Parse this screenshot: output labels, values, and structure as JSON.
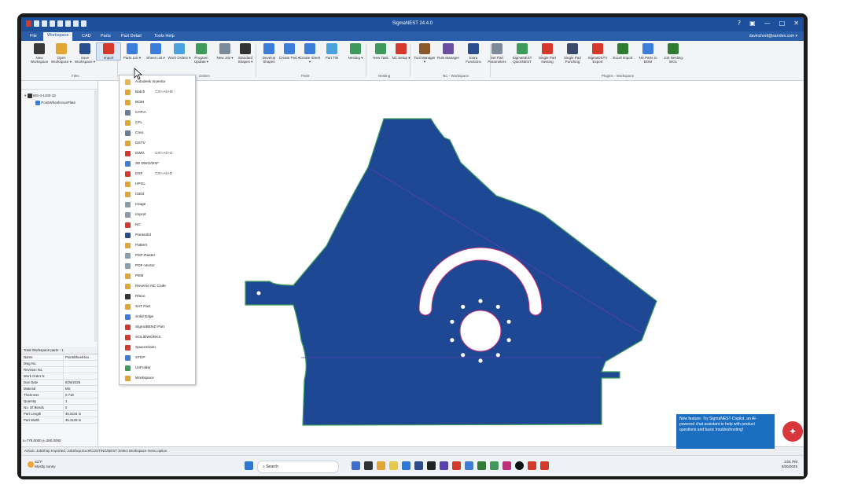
{
  "app": {
    "title": "SigmaNEST 24.4.0",
    "user": "davinchord@sarrdeo.com ▾",
    "window_buttons": [
      "?",
      "▣",
      "—",
      "□",
      "✕"
    ]
  },
  "menu_tabs": [
    "File",
    "Workspace",
    "CAD",
    "Parts",
    "Part Detail",
    "Tools Help"
  ],
  "ribbon": {
    "buttons": [
      {
        "label": "New Workspace",
        "color": "#3a3a3a"
      },
      {
        "label": "Open Workspace ▾",
        "color": "#e0a533"
      },
      {
        "label": "Save Workspace ▾",
        "color": "#2a4d8f"
      },
      {
        "label": "Import",
        "color": "#d6392b"
      },
      {
        "label": "Parts List ▾",
        "color": "#3b7dd8"
      },
      {
        "label": "Sheet List ▾",
        "color": "#3b7dd8"
      },
      {
        "label": "Work Orders ▾",
        "color": "#4aa3df"
      },
      {
        "label": "Program Update ▾",
        "color": "#3e9a5a"
      },
      {
        "label": "New Job ▾",
        "color": "#7c8a9a"
      },
      {
        "label": "Standard Shapes ▾",
        "color": "#333333"
      },
      {
        "label": "Develop Shapes",
        "color": "#3b7dd8"
      },
      {
        "label": "Create Part ▾",
        "color": "#3b7dd8"
      },
      {
        "label": "Create Sheet ▾",
        "color": "#3b7dd8"
      },
      {
        "label": "Part Tile",
        "color": "#4aa3df"
      },
      {
        "label": "Nesting ▾",
        "color": "#3e9a5a"
      },
      {
        "label": "New Task",
        "color": "#3e9a5a"
      },
      {
        "label": "NC Setup ▾",
        "color": "#d6392b"
      },
      {
        "label": "Tool Manager ▾",
        "color": "#8a5a2b"
      },
      {
        "label": "Rule Manager",
        "color": "#6a4fa3"
      },
      {
        "label": "Extra Functions",
        "color": "#2a4d8f"
      },
      {
        "label": "Set Part Parameters",
        "color": "#7c8a9a"
      },
      {
        "label": "SigmaNEST QuickNEST",
        "color": "#3e9a5a"
      },
      {
        "label": "Single Part Nesting",
        "color": "#d6392b"
      },
      {
        "label": "Single Part Punching",
        "color": "#3b4a6b"
      },
      {
        "label": "SigmaDSTV Export",
        "color": "#d6392b"
      },
      {
        "label": "Excel Import",
        "color": "#2e7d32"
      },
      {
        "label": "NS Parts to BOM",
        "color": "#3b7dd8"
      },
      {
        "label": "Job Nesting WOL",
        "color": "#2e7d32"
      }
    ],
    "groups": [
      "Files",
      "Orders",
      "Parts",
      "Nesting",
      "NC - Workspace",
      "Plugins - Workspace"
    ]
  },
  "tree": {
    "root": "WS-4-1160-15",
    "child": "PointWheelHousPlate"
  },
  "properties": {
    "title": "Total Workspace parts : 1",
    "rows": [
      {
        "k": "Name",
        "v": "PointWheelHou"
      },
      {
        "k": "Dwg No.",
        "v": ""
      },
      {
        "k": "Revision No.",
        "v": ""
      },
      {
        "k": "Work Order N",
        "v": ""
      },
      {
        "k": "Due Date",
        "v": "8/26/2025"
      },
      {
        "k": "Material",
        "v": "MS"
      },
      {
        "k": "Thickness",
        "v": "0.718"
      },
      {
        "k": "Quantity",
        "v": "1"
      },
      {
        "k": "No. Of Bends",
        "v": "0"
      },
      {
        "k": "Part Length",
        "v": "46.0234 in"
      },
      {
        "k": "Part Width",
        "v": "35.3129 in"
      }
    ],
    "coord": "x=778.0000 y=260.0000"
  },
  "status": "Action: JobShop    Imported: JobShop.ExcelCOSTING/NEST    Select Workspace menu option",
  "import_menu": [
    {
      "label": "Autodesk Inventor",
      "shortcut": "",
      "color": "#e8b64a"
    },
    {
      "label": "Batch",
      "shortcut": "Ctrl+Alt+M",
      "color": "#e0a533"
    },
    {
      "label": "BOM",
      "shortcut": "",
      "color": "#e0a533"
    },
    {
      "label": "CATIA",
      "shortcut": "",
      "color": "#6a7d96"
    },
    {
      "label": "CFL",
      "shortcut": "",
      "color": "#e0a533"
    },
    {
      "label": "Creo",
      "shortcut": "",
      "color": "#6a7d96"
    },
    {
      "label": "DSTV",
      "shortcut": "",
      "color": "#e0a533"
    },
    {
      "label": "DWG",
      "shortcut": "Ctrl+Alt+G",
      "color": "#d6392b"
    },
    {
      "label": "3D DWG/DXF",
      "shortcut": "",
      "color": "#3b7dd8"
    },
    {
      "label": "DXF",
      "shortcut": "Ctrl+Alt+D",
      "color": "#d6392b"
    },
    {
      "label": "HPGL",
      "shortcut": "",
      "color": "#e0a533"
    },
    {
      "label": "IGES",
      "shortcut": "",
      "color": "#e0a533"
    },
    {
      "label": "Image",
      "shortcut": "",
      "color": "#8a9aa8"
    },
    {
      "label": "Import",
      "shortcut": "",
      "color": "#8a9aa8"
    },
    {
      "label": "NC",
      "shortcut": "",
      "color": "#d6392b"
    },
    {
      "label": "Parasolid",
      "shortcut": "",
      "color": "#2a4d8f"
    },
    {
      "label": "Pattern",
      "shortcut": "",
      "color": "#e0a533"
    },
    {
      "label": "PDF-Raster",
      "shortcut": "",
      "color": "#8a9aa8"
    },
    {
      "label": "PDF-Vector",
      "shortcut": "",
      "color": "#8a9aa8"
    },
    {
      "label": "PEM",
      "shortcut": "",
      "color": "#e0a533"
    },
    {
      "label": "Reverse NC Code",
      "shortcut": "",
      "color": "#e0a533"
    },
    {
      "label": "Rhino",
      "shortcut": "",
      "color": "#333333"
    },
    {
      "label": "SAT Part",
      "shortcut": "",
      "color": "#e0a533"
    },
    {
      "label": "Solid Edge",
      "shortcut": "",
      "color": "#3b7dd8"
    },
    {
      "label": "SigmaBEND Part",
      "shortcut": "",
      "color": "#d6392b"
    },
    {
      "label": "SOLIDWORKS",
      "shortcut": "",
      "color": "#d6392b"
    },
    {
      "label": "SpaceClaim",
      "shortcut": "",
      "color": "#d6392b"
    },
    {
      "label": "STEP",
      "shortcut": "",
      "color": "#3b7dd8"
    },
    {
      "label": "UnFolder",
      "shortcut": "",
      "color": "#3e9a5a"
    },
    {
      "label": "Workspace",
      "shortcut": "",
      "color": "#e0a533"
    }
  ],
  "notification": {
    "text": "New feature: Try SigmaNEST Copilot, an AI-powered chat assistant to help with product questions and basic troubleshooting!"
  },
  "taskbar": {
    "weather_temp": "61°F",
    "weather_desc": "Mostly sunny",
    "search_placeholder": "Search",
    "time": "3:01 PM",
    "date": "8/26/2025"
  },
  "colors": {
    "titlebar": "#1e4f9a",
    "part_fill": "#1f4894",
    "part_edge": "#3da05a",
    "cutout_edge": "#c0307a"
  }
}
